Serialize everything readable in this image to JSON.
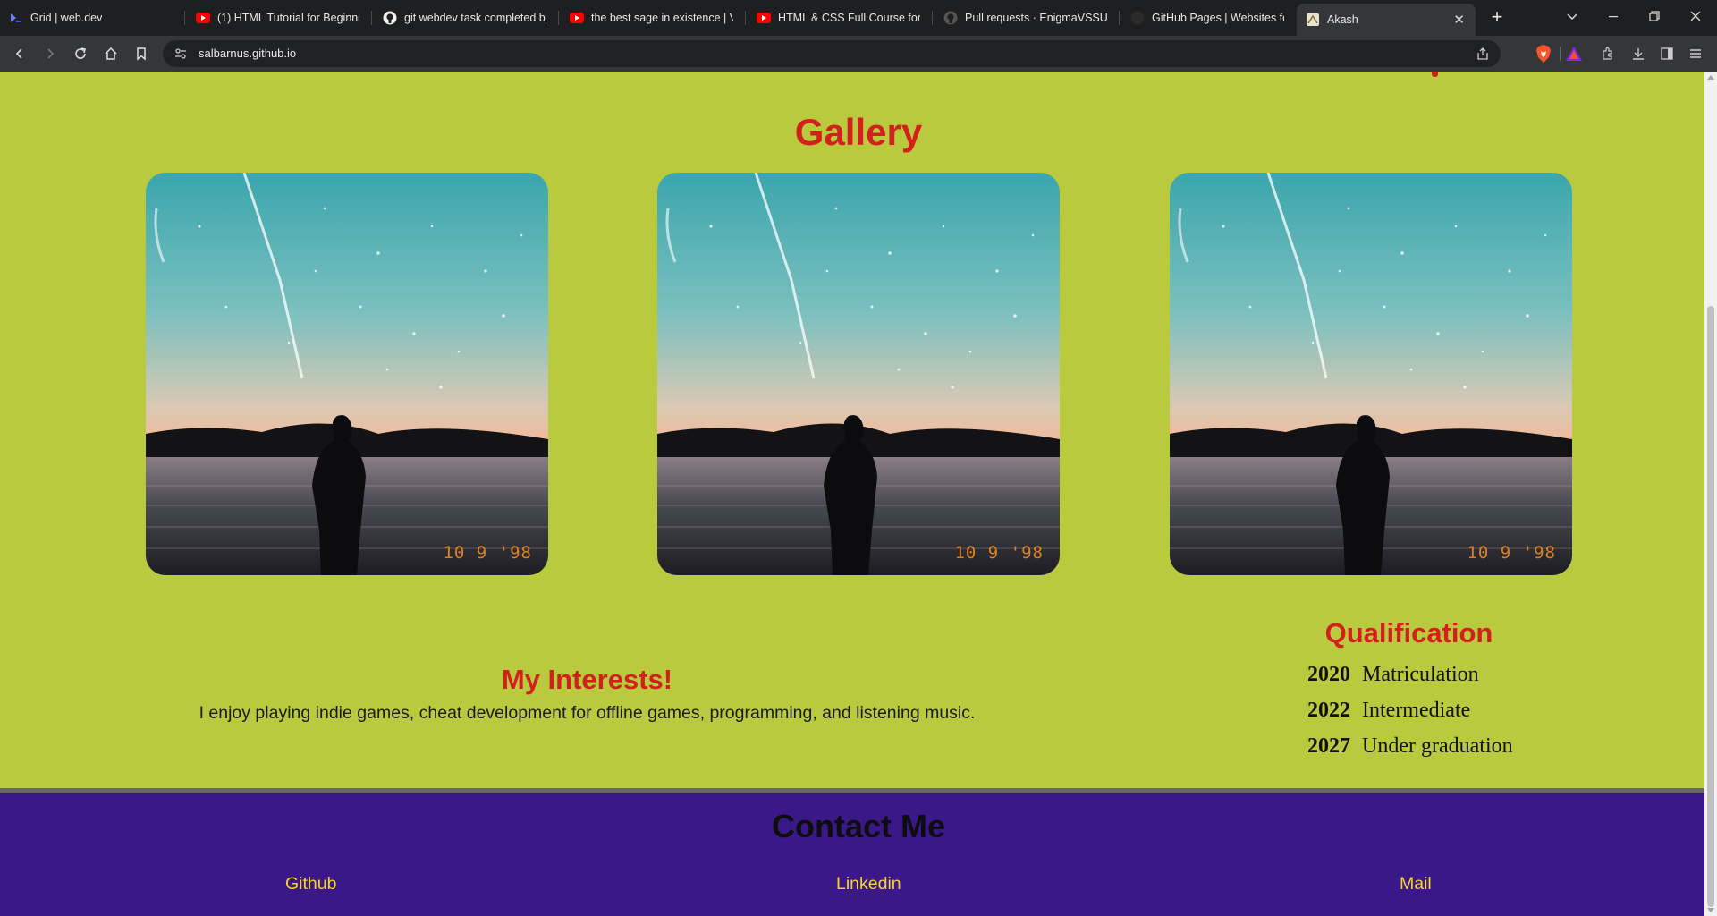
{
  "browser": {
    "tabs": [
      {
        "label": "Grid  |  web.dev",
        "icon": "webdev-icon"
      },
      {
        "label": "(1) HTML Tutorial for Beginners",
        "icon": "youtube-icon"
      },
      {
        "label": "git webdev task completed by",
        "icon": "github-icon"
      },
      {
        "label": "the best sage in existence | VA",
        "icon": "youtube-icon"
      },
      {
        "label": "HTML & CSS Full Course for fr",
        "icon": "youtube-icon"
      },
      {
        "label": "Pull requests · EnigmaVSSUT/",
        "icon": "github-icon"
      },
      {
        "label": "GitHub Pages | Websites for yo",
        "icon": "github-icon"
      },
      {
        "label": "Akash",
        "icon": "page-icon",
        "active": true
      }
    ],
    "url": "salbarnus.github.io"
  },
  "page": {
    "gallery_title": "Gallery",
    "photo_stamp": "10 9 '98",
    "interests_title": "My Interests!",
    "interests_text": "I enjoy playing indie games, cheat development for offline games, programming, and listening music.",
    "qualification_title": "Qualification",
    "qualifications": [
      {
        "year": "2020",
        "label": "Matriculation"
      },
      {
        "year": "2022",
        "label": "Intermediate"
      },
      {
        "year": "2027",
        "label": "Under graduation"
      }
    ],
    "contact_title": "Contact Me",
    "contact_links": [
      {
        "label": "Github"
      },
      {
        "label": "Linkedin"
      },
      {
        "label": "Mail"
      }
    ]
  },
  "colors": {
    "page_bg": "#b9ca3f",
    "heading_red": "#d41f1f",
    "footer_bg": "#3a1887",
    "link_yellow": "#f4d428"
  }
}
